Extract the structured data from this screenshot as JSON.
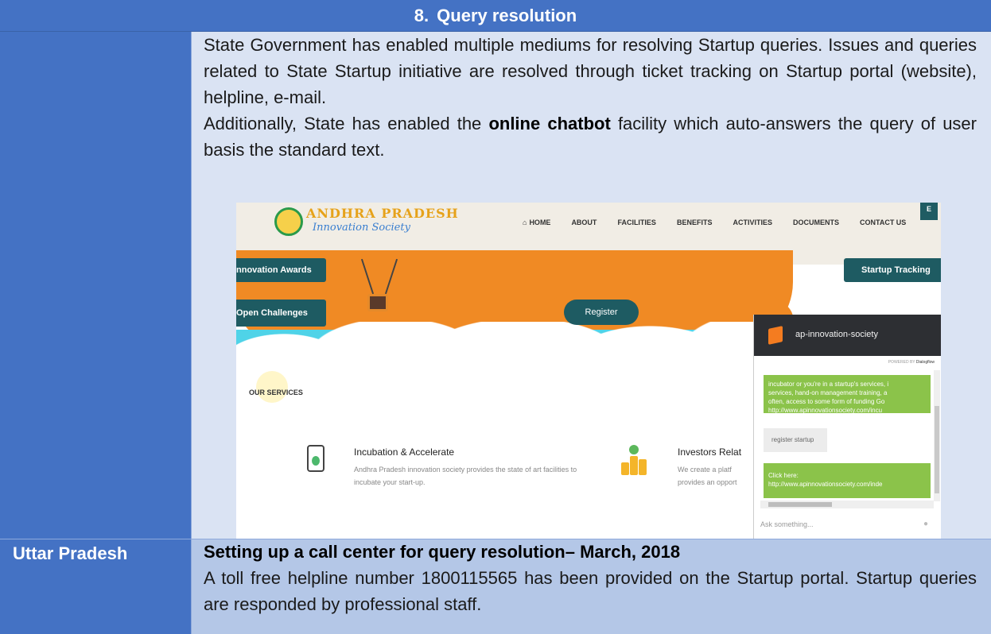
{
  "section": {
    "number": "8.",
    "title": "Query resolution"
  },
  "intro": {
    "p1": "State Government has enabled multiple mediums for resolving Startup queries. Issues and queries related to State Startup initiative are resolved through ticket tracking on Startup portal (website), helpline, e-mail.",
    "p2_before": "Additionally, State has enabled the ",
    "p2_bold": "online chatbot",
    "p2_after": " facility which auto-answers the query of user basis the standard text."
  },
  "screenshot": {
    "logo_title": "ANDHRA PRADESH",
    "logo_subtitle": "Innovation Society",
    "nav": [
      "HOME",
      "ABOUT",
      "FACILITIES",
      "BENEFITS",
      "ACTIVITIES",
      "DOCUMENTS",
      "CONTACT US"
    ],
    "corner_tab": "E",
    "buttons": {
      "awards": "nnovation Awards",
      "challenges": "Open Challenges",
      "tracking": "Startup Tracking",
      "register": "Register"
    },
    "services_label": "OUR SERVICES",
    "service1": {
      "title": "Incubation & Accelerate",
      "desc": "Andhra Pradesh innovation society provides the state of art facilities to incubate your start-up."
    },
    "service2": {
      "title": "Investors Relat",
      "desc_line1": "We create a platf",
      "desc_line2": "provides an opport"
    },
    "chat": {
      "title": "ap-innovation-society",
      "powered_by": "POWERED BY",
      "powered_brand": "Dialogflow",
      "msg1_line1": "incubator or you're in a startup's services, i",
      "msg1_line2": "services, hand-on management training, a",
      "msg1_line3": "often, access to some form of funding Go",
      "msg1_line4": "http://www.apinnovationsociety.com/incu",
      "user_msg": "register startup",
      "msg2_line1": "Click here:",
      "msg2_line2": "http://www.apinnovationsociety.com/inde",
      "input_placeholder": "Ask something..."
    }
  },
  "row2": {
    "state": "Uttar Pradesh",
    "title": "Setting up a call center for query resolution– March, 2018",
    "body": "A toll free helpline number 1800115565 has been provided on the Startup portal. Startup queries are responded by professional staff."
  },
  "colors": {
    "header_blue": "#4472c4",
    "light_blue": "#dae3f3",
    "mid_blue": "#b4c7e7"
  }
}
